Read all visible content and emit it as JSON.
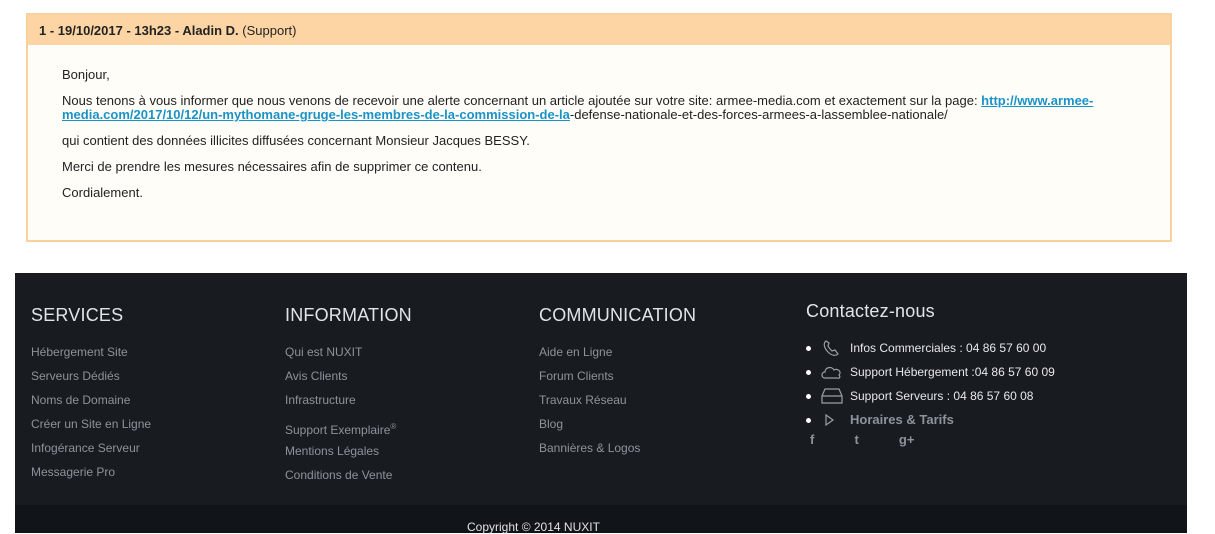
{
  "ticket": {
    "header_prefix": "1 - 19/10/2017 - 13h23 - Aladin D.",
    "header_role": "(Support)",
    "greeting": "Bonjour,",
    "para1_start": "Nous tenons à vous informer que nous venons de recevoir une alerte concernant un article ajoutée sur votre site: armee-media.com et exactement sur la page: ",
    "link_text": "http://www.armee-media.com/2017/10/12/un-mythomane-gruge-les-membres-de-la-commission-de-la",
    "link_suffix": "-defense-nationale-et-des-forces-armees-a-lassemblee-nationale/",
    "para2": "qui contient des données illicites diffusées concernant Monsieur Jacques BESSY.",
    "para3": "Merci de prendre les mesures nécessaires afin de supprimer ce contenu.",
    "closing": "Cordialement."
  },
  "footer": {
    "services": {
      "title": "SERVICES",
      "items": [
        "Hébergement Site",
        "Serveurs Dédiés",
        "Noms de Domaine",
        "Créer un Site en Ligne",
        "Infogérance Serveur",
        "Messagerie Pro"
      ]
    },
    "information": {
      "title": "INFORMATION",
      "items": [
        "Qui est NUXIT",
        "Avis Clients",
        "Infrastructure",
        "Support Exemplaire",
        "Mentions Légales",
        "Conditions de Vente"
      ],
      "registered_mark": "®"
    },
    "communication": {
      "title": "COMMUNICATION",
      "items": [
        "Aide en Ligne",
        "Forum Clients",
        "Travaux Réseau",
        "Blog",
        "Bannières & Logos"
      ]
    },
    "contact": {
      "title": "Contactez-nous",
      "items": [
        {
          "label": "Infos Commerciales :",
          "value": " 04 86 57 60 00",
          "icon": "phone-icon"
        },
        {
          "label": "Support Hébergement :",
          "value": "04 86 57 60 09",
          "icon": "cloud-icon"
        },
        {
          "label": "Support Serveurs :",
          "value": " 04 86 57 60 08",
          "icon": "server-icon"
        }
      ],
      "hours": "Horaires & Tarifs",
      "social": [
        "f",
        "t",
        "g+"
      ]
    },
    "copyright": "Copyright © 2014 NUXIT"
  }
}
